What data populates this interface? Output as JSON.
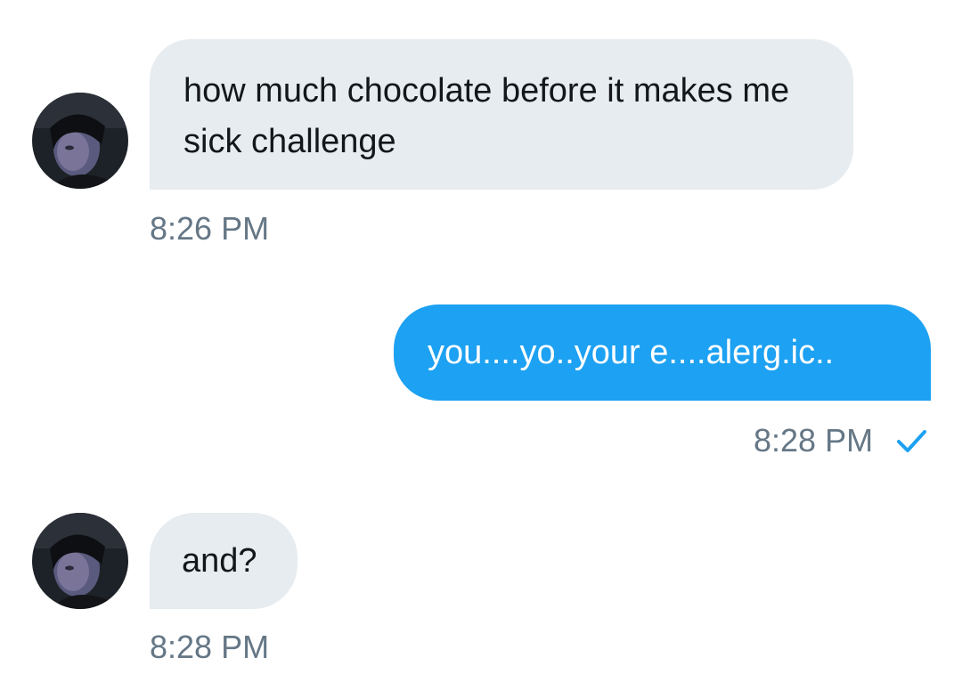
{
  "messages": [
    {
      "direction": "incoming",
      "text": "how much chocolate before it makes me sick challenge",
      "time": "8:26 PM",
      "avatar": "contact-avatar"
    },
    {
      "direction": "outgoing",
      "text": "you....yo..your e....alerg.ic..",
      "time": "8:28 PM",
      "status_icon": "checkmark-icon"
    },
    {
      "direction": "incoming",
      "text": "and?",
      "time": "8:28 PM",
      "avatar": "contact-avatar"
    }
  ],
  "colors": {
    "incoming_bubble": "#e6ecf0",
    "outgoing_bubble": "#1da1f2",
    "timestamp": "#657786",
    "read_check": "#1da1f2"
  }
}
